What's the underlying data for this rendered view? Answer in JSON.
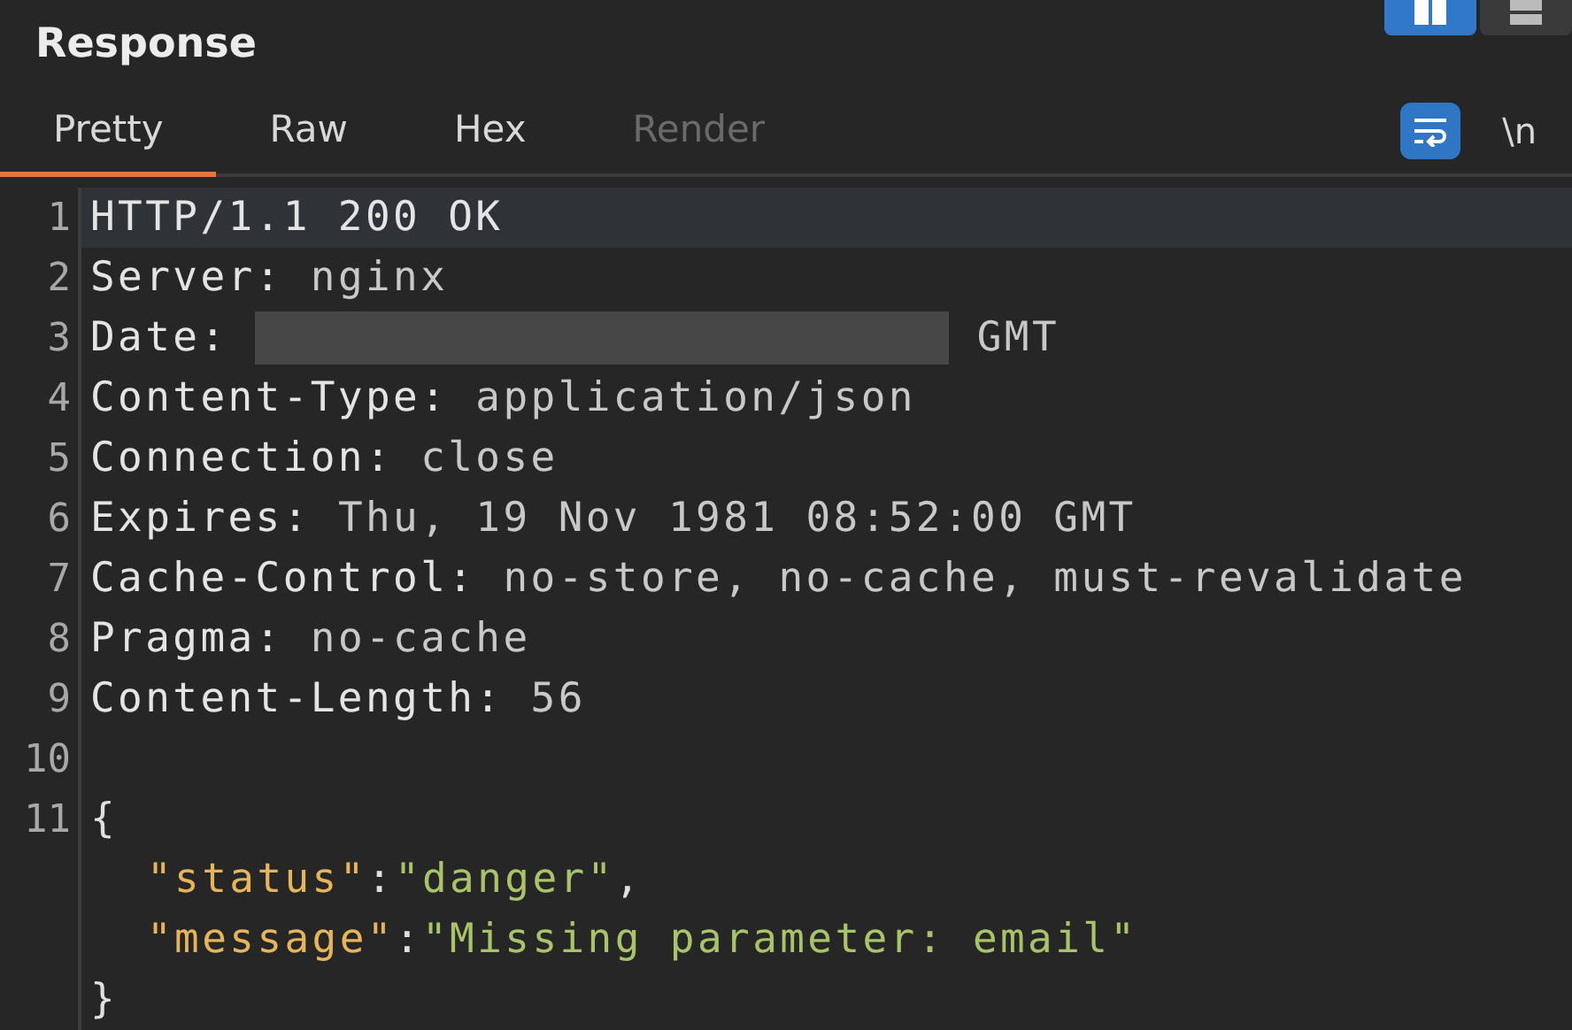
{
  "panel": {
    "title": "Response"
  },
  "view_toggle": [
    {
      "kind": "columns",
      "selected": true
    },
    {
      "kind": "rows",
      "selected": false
    }
  ],
  "tabs": [
    {
      "label": "Pretty",
      "selected": true,
      "disabled": false
    },
    {
      "label": "Raw",
      "selected": false,
      "disabled": false
    },
    {
      "label": "Hex",
      "selected": false,
      "disabled": false
    },
    {
      "label": "Render",
      "selected": false,
      "disabled": true
    }
  ],
  "toolbar": {
    "wrap_on": true,
    "newline_label": "\\n"
  },
  "lines": [
    {
      "number": "1",
      "current": true,
      "segments": [
        {
          "kind": "key",
          "text": "HTTP/1.1 200 OK"
        }
      ]
    },
    {
      "number": "2",
      "current": false,
      "segments": [
        {
          "kind": "key",
          "text": "Server: "
        },
        {
          "kind": "value",
          "text": "nginx"
        }
      ]
    },
    {
      "number": "3",
      "current": false,
      "segments": [
        {
          "kind": "key",
          "text": "Date: "
        },
        {
          "kind": "redacted"
        },
        {
          "kind": "value",
          "text": " GMT"
        }
      ]
    },
    {
      "number": "4",
      "current": false,
      "segments": [
        {
          "kind": "key",
          "text": "Content-Type: "
        },
        {
          "kind": "value",
          "text": "application/json"
        }
      ]
    },
    {
      "number": "5",
      "current": false,
      "segments": [
        {
          "kind": "key",
          "text": "Connection: "
        },
        {
          "kind": "value",
          "text": "close"
        }
      ]
    },
    {
      "number": "6",
      "current": false,
      "segments": [
        {
          "kind": "key",
          "text": "Expires: "
        },
        {
          "kind": "value",
          "text": "Thu, 19 Nov 1981 08:52:00 GMT"
        }
      ]
    },
    {
      "number": "7",
      "current": false,
      "segments": [
        {
          "kind": "key",
          "text": "Cache-Control: "
        },
        {
          "kind": "value",
          "text": "no-store, no-cache, must-revalidate"
        }
      ]
    },
    {
      "number": "8",
      "current": false,
      "segments": [
        {
          "kind": "key",
          "text": "Pragma: "
        },
        {
          "kind": "value",
          "text": "no-cache"
        }
      ]
    },
    {
      "number": "9",
      "current": false,
      "segments": [
        {
          "kind": "key",
          "text": "Content-Length: "
        },
        {
          "kind": "value",
          "text": "56"
        }
      ]
    },
    {
      "number": "10",
      "current": false
    },
    {
      "number": "11",
      "current": false,
      "segments": [
        {
          "kind": "punct",
          "text": "{"
        }
      ]
    },
    {
      "current": false,
      "indented": true,
      "segments": [
        {
          "kind": "json_key",
          "text": "\"status\""
        },
        {
          "kind": "punct",
          "text": ":"
        },
        {
          "kind": "json_string",
          "text": "\"danger\""
        },
        {
          "kind": "punct",
          "text": ","
        }
      ]
    },
    {
      "current": false,
      "indented": true,
      "segments": [
        {
          "kind": "json_key",
          "text": "\"message\""
        },
        {
          "kind": "punct",
          "text": ":"
        },
        {
          "kind": "json_string",
          "text": "\"Missing parameter: email\""
        }
      ]
    },
    {
      "current": false,
      "segments": [
        {
          "kind": "punct",
          "text": "}"
        }
      ]
    }
  ]
}
